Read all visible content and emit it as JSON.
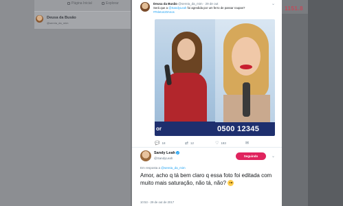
{
  "background": {
    "nav": {
      "home_label": "Página Inicial",
      "explore_label": "Explorar"
    },
    "profile_card": {
      "name": "Deusa da Busão",
      "handle": "@sereia_da_mim"
    },
    "right_text": "1151.8"
  },
  "quoted_tweet": {
    "name": "Deusa da Busão",
    "handle": "@sereia_da_mim",
    "date": "· 29 de out",
    "text_before": "Será que a ",
    "mention": "@SandyLeah",
    "text_after": " foi agredida por um ferro de passar roupas?",
    "hashtag": "#Teleton20Anos",
    "photo": {
      "left_caption": "or",
      "right_caption": "0500 12345"
    }
  },
  "actions": {
    "replies": "18",
    "retweets": "12",
    "likes": "183"
  },
  "main_tweet": {
    "name": "Sandy Leah",
    "verified_mark": "✓",
    "handle": "@SandyLeah",
    "follow_label": "Seguindo",
    "reply_prefix": "Em resposta a ",
    "reply_to": "@sereia_da_mim",
    "text": "Amor, acho q tá bem claro q essa foto foi editada com muito mais saturação, não tá, não?",
    "timestamp": "10:53 - 29 de out de 2017"
  },
  "colors": {
    "link": "#1da1f2",
    "follow_button": "#e0245e",
    "tv_bar": "#1e2f6e"
  }
}
